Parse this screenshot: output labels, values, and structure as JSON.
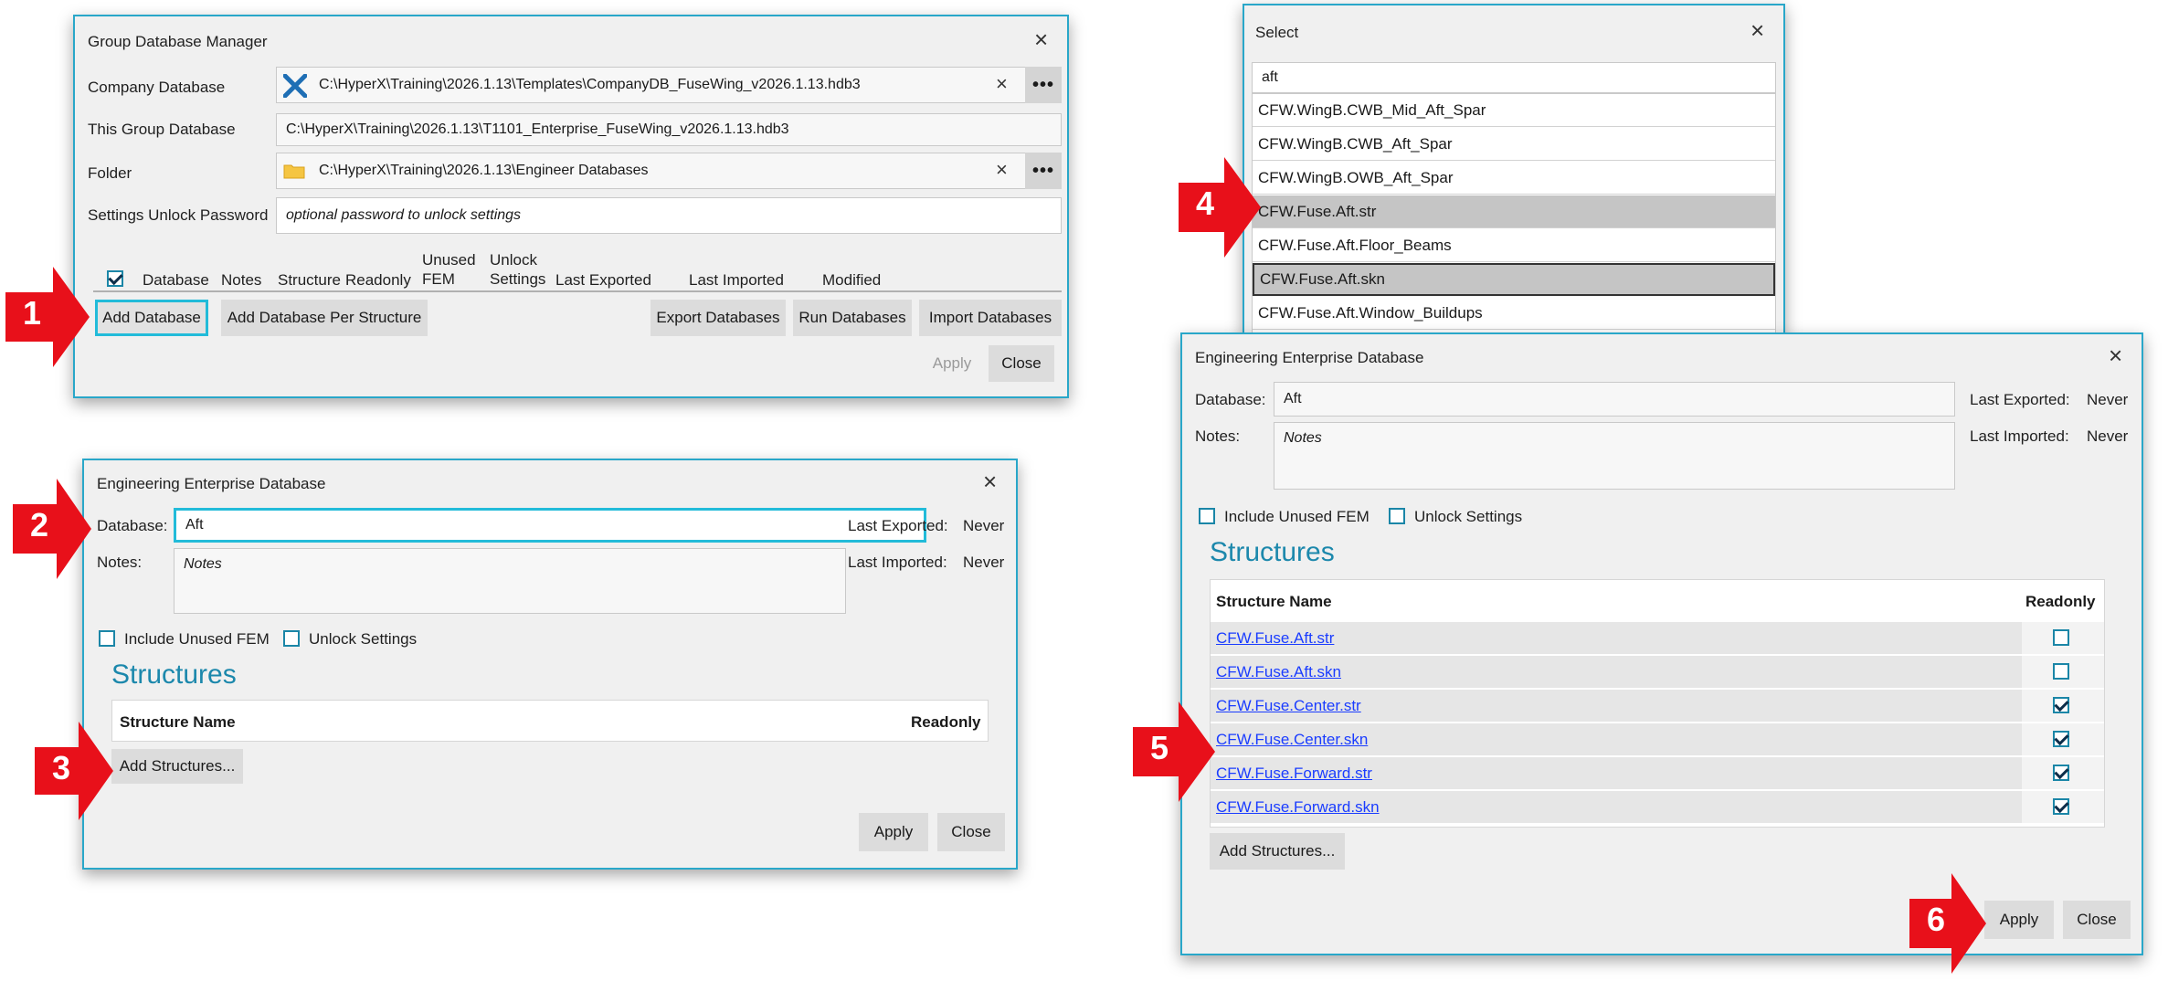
{
  "gdm": {
    "title": "Group Database Manager",
    "company_db_label": "Company Database",
    "company_db_value": "C:\\HyperX\\Training\\2026.1.13\\Templates\\CompanyDB_FuseWing_v2026.1.13.hdb3",
    "group_db_label": "This Group Database",
    "group_db_value": "C:\\HyperX\\Training\\2026.1.13\\T1101_Enterprise_FuseWing_v2026.1.13.hdb3",
    "folder_label": "Folder",
    "folder_value": "C:\\HyperX\\Training\\2026.1.13\\Engineer Databases",
    "password_label": "Settings Unlock Password",
    "password_placeholder": "optional password to unlock settings",
    "columns": {
      "database": "Database",
      "notes": "Notes",
      "structure": "Structure",
      "readonly": "Readonly",
      "unused_1": "Unused",
      "unused_2": "FEM",
      "unlock_1": "Unlock",
      "unlock_2": "Settings",
      "last_exported": "Last Exported",
      "last_imported": "Last Imported",
      "modified": "Modified"
    },
    "buttons": {
      "add_database": "Add Database",
      "add_per_structure": "Add Database Per Structure",
      "export": "Export Databases",
      "run": "Run Databases",
      "import": "Import Databases",
      "apply": "Apply",
      "close": "Close"
    }
  },
  "select": {
    "title": "Select",
    "search": "aft",
    "items": [
      "CFW.WingB.CWB_Mid_Aft_Spar",
      "CFW.WingB.CWB_Aft_Spar",
      "CFW.WingB.OWB_Aft_Spar",
      "CFW.Fuse.Aft.str",
      "CFW.Fuse.Aft.Floor_Beams",
      "CFW.Fuse.Aft.skn",
      "CFW.Fuse.Aft.Window_Buildups"
    ]
  },
  "eed1": {
    "title": "Engineering Enterprise Database",
    "database_label": "Database:",
    "database_value": "Aft",
    "notes_label": "Notes:",
    "notes_placeholder": "Notes",
    "last_exported_label": "Last Exported:",
    "last_exported_value": "Never",
    "last_imported_label": "Last Imported:",
    "last_imported_value": "Never",
    "include_unused": "Include Unused FEM",
    "unlock_settings": "Unlock Settings",
    "structures_heading": "Structures",
    "col_structure": "Structure Name",
    "col_readonly": "Readonly",
    "add_structures": "Add Structures...",
    "apply": "Apply",
    "close": "Close"
  },
  "eed2": {
    "title": "Engineering Enterprise Database",
    "database_label": "Database:",
    "database_value": "Aft",
    "notes_label": "Notes:",
    "notes_placeholder": "Notes",
    "last_exported_label": "Last Exported:",
    "last_exported_value": "Never",
    "last_imported_label": "Last Imported:",
    "last_imported_value": "Never",
    "include_unused": "Include Unused FEM",
    "unlock_settings": "Unlock Settings",
    "structures_heading": "Structures",
    "col_structure": "Structure Name",
    "col_readonly": "Readonly",
    "rows": [
      {
        "name": "CFW.Fuse.Aft.str",
        "readonly": false
      },
      {
        "name": "CFW.Fuse.Aft.skn",
        "readonly": false
      },
      {
        "name": "CFW.Fuse.Center.str",
        "readonly": true
      },
      {
        "name": "CFW.Fuse.Center.skn",
        "readonly": true
      },
      {
        "name": "CFW.Fuse.Forward.str",
        "readonly": true
      },
      {
        "name": "CFW.Fuse.Forward.skn",
        "readonly": true
      }
    ],
    "add_structures": "Add Structures...",
    "apply": "Apply",
    "close": "Close"
  },
  "callouts": [
    "1",
    "2",
    "3",
    "4",
    "5",
    "6"
  ],
  "colors": {
    "window_border": "#29a7c9",
    "focus": "#22bbd9",
    "heading": "#1c88ac",
    "callout": "#e8101a",
    "link": "#1a3cff"
  }
}
